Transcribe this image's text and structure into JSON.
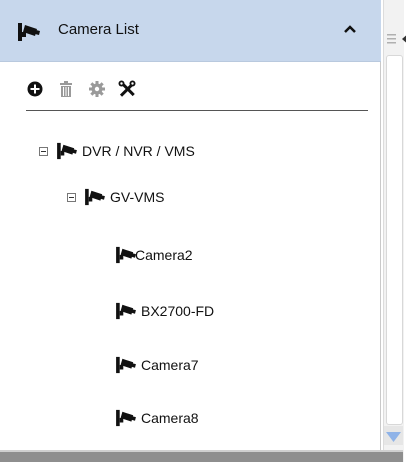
{
  "panel": {
    "title": "Camera List",
    "header_icon": "camera-icon",
    "collapse_icon": "chevron-up-icon"
  },
  "toolbar": {
    "add_icon": "add-icon",
    "delete_icon": "trash-icon",
    "settings_icon": "gear-icon",
    "tools_icon": "tools-icon"
  },
  "tree": {
    "root": {
      "label": "DVR / NVR / VMS"
    },
    "group": {
      "label": "GV-VMS"
    },
    "cameras": [
      {
        "label": "Camera2"
      },
      {
        "label": "BX2700-FD"
      },
      {
        "label": "Camera7"
      },
      {
        "label": "Camera8"
      }
    ]
  },
  "colors": {
    "header_bg": "#c7d7ec",
    "scroll_arrow": "#8fb3e8"
  }
}
